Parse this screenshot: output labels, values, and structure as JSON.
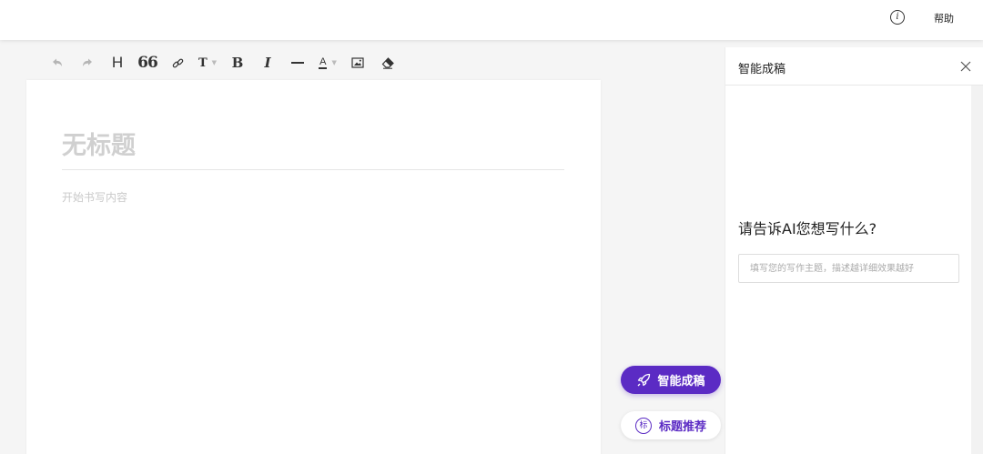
{
  "header": {
    "help_label": "帮助",
    "info_icon": "info-icon",
    "info_glyph": "i"
  },
  "toolbar": {
    "items": [
      {
        "name": "undo-icon",
        "state": "disabled"
      },
      {
        "name": "redo-icon",
        "state": "disabled"
      },
      {
        "name": "heading-icon",
        "glyph": "H"
      },
      {
        "name": "quote-icon",
        "glyph": "66"
      },
      {
        "name": "link-icon"
      },
      {
        "name": "text-size-icon",
        "glyph": "T",
        "dropdown": true
      },
      {
        "name": "bold-icon",
        "glyph": "B"
      },
      {
        "name": "italic-icon",
        "glyph": "I"
      },
      {
        "name": "horizontal-rule-icon"
      },
      {
        "name": "font-color-icon",
        "glyph": "A",
        "dropdown": true
      },
      {
        "name": "image-icon"
      },
      {
        "name": "eraser-icon"
      }
    ],
    "caret_glyph": "▼"
  },
  "editor": {
    "title_placeholder": "无标题",
    "body_placeholder": "开始书写内容"
  },
  "floating": {
    "ai_button_label": "智能成稿",
    "title_button_label": "标题推荐",
    "title_button_icon_glyph": "标"
  },
  "panel": {
    "title": "智能成稿",
    "prompt": "请告诉AI您想写什么?",
    "input_placeholder": "填写您的写作主题，描述越详细效果越好"
  },
  "colors": {
    "accent": "#5b2bc4",
    "background": "#f5f5f5",
    "placeholder": "#d0d0d0"
  }
}
